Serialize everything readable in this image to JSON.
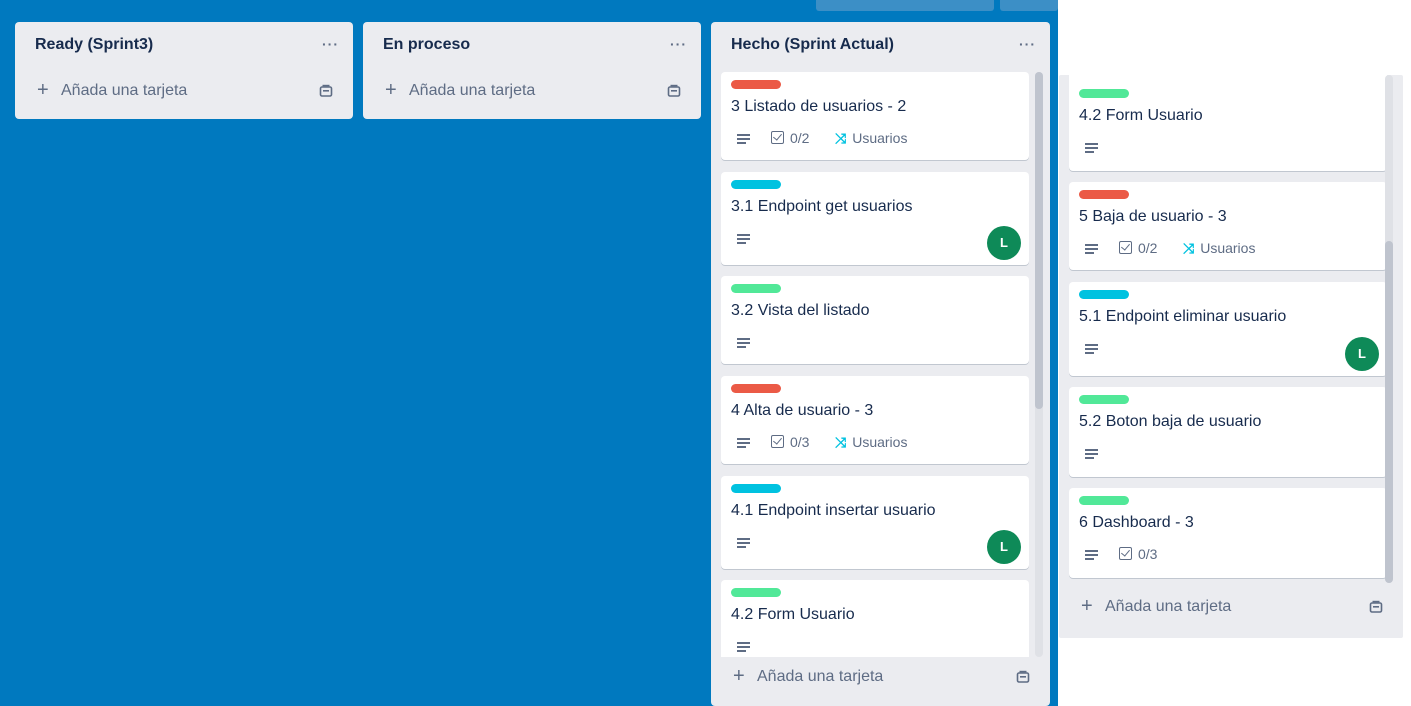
{
  "colors": {
    "board_bg": "#0079bf",
    "label_red": "#eb5a46",
    "label_cyan": "#00c2e0",
    "label_green": "#51e898",
    "avatar_green": "#0e8a58"
  },
  "board": {
    "lists": [
      {
        "title": "Ready (Sprint3)",
        "menu": "···",
        "add_label": "Añada una tarjeta"
      },
      {
        "title": "En proceso",
        "menu": "···",
        "add_label": "Añada una tarjeta"
      },
      {
        "title": "Hecho (Sprint Actual)",
        "menu": "···",
        "add_label": "Añada una tarjeta",
        "cards": [
          {
            "label_color": "red",
            "title": "3 Listado de usuarios - 2",
            "checklist": "0/2",
            "tag": "Usuarios"
          },
          {
            "label_color": "cyan",
            "title": "3.1 Endpoint get usuarios",
            "member": "L"
          },
          {
            "label_color": "green",
            "title": "3.2 Vista del listado"
          },
          {
            "label_color": "red",
            "title": "4 Alta de usuario - 3",
            "checklist": "0/3",
            "tag": "Usuarios"
          },
          {
            "label_color": "cyan",
            "title": "4.1 Endpoint insertar usuario",
            "member": "L"
          },
          {
            "label_color": "green",
            "title": "4.2 Form Usuario"
          }
        ]
      }
    ]
  },
  "overlay_list": {
    "add_label": "Añada una tarjeta",
    "cards": [
      {
        "label_color": "green",
        "title": "4.2 Form Usuario"
      },
      {
        "label_color": "red",
        "title": "5 Baja de usuario - 3",
        "checklist": "0/2",
        "tag": "Usuarios"
      },
      {
        "label_color": "cyan",
        "title": "5.1 Endpoint eliminar usuario",
        "member": "L"
      },
      {
        "label_color": "green",
        "title": "5.2 Boton baja de usuario"
      },
      {
        "label_color": "green",
        "title": "6 Dashboard - 3",
        "checklist": "0/3"
      }
    ]
  }
}
